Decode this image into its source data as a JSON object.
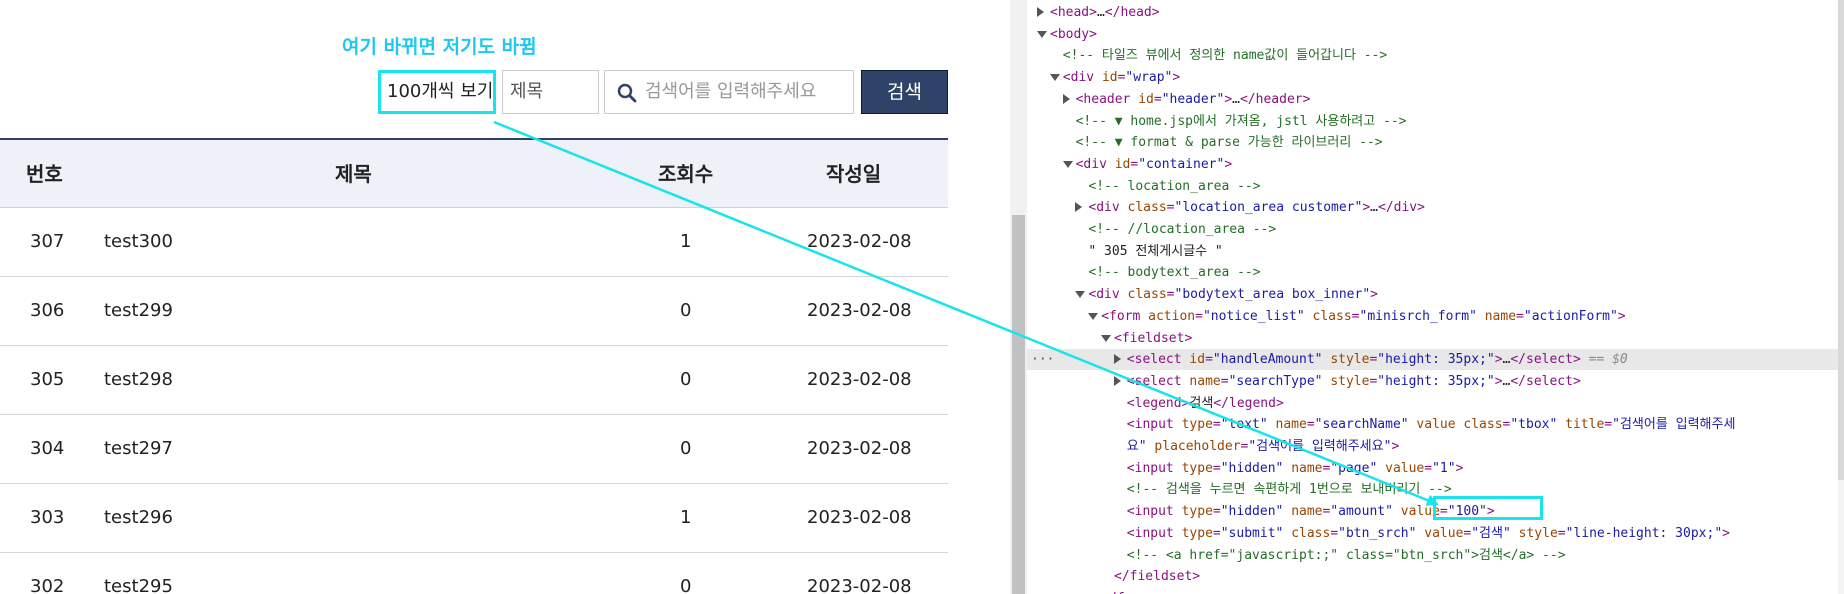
{
  "annotation": {
    "note": "여기 바뀌면 저기도 바뀜",
    "color": "#19e3ec"
  },
  "search": {
    "amount_select": "100개씩 보기",
    "type_select": "제목",
    "placeholder": "검색어를 입력해주세요",
    "button": "검색",
    "search_icon": "search-icon"
  },
  "table": {
    "headers": {
      "no": "번호",
      "title": "제목",
      "views": "조회수",
      "date": "작성일"
    },
    "rows": [
      {
        "no": "307",
        "title": "test300",
        "views": "1",
        "date": "2023-02-08"
      },
      {
        "no": "306",
        "title": "test299",
        "views": "0",
        "date": "2023-02-08"
      },
      {
        "no": "305",
        "title": "test298",
        "views": "0",
        "date": "2023-02-08"
      },
      {
        "no": "304",
        "title": "test297",
        "views": "0",
        "date": "2023-02-08"
      },
      {
        "no": "303",
        "title": "test296",
        "views": "1",
        "date": "2023-02-08"
      },
      {
        "no": "302",
        "title": "test295",
        "views": "0",
        "date": "2023-02-08"
      }
    ]
  },
  "devtools": {
    "lines": [
      {
        "indent": 0,
        "tri": "right",
        "parts": [
          [
            "tag",
            "<head>"
          ],
          [
            "txt",
            "…"
          ],
          [
            "tag",
            "</head>"
          ]
        ]
      },
      {
        "indent": 0,
        "tri": "down",
        "parts": [
          [
            "tag",
            "<body>"
          ]
        ]
      },
      {
        "indent": 1,
        "tri": "",
        "parts": [
          [
            "comment",
            "<!-- 타일즈 뷰에서 정의한 name값이 들어갑니다 -->"
          ]
        ]
      },
      {
        "indent": 1,
        "tri": "down",
        "parts": [
          [
            "tag",
            "<div "
          ],
          [
            "attr",
            "id"
          ],
          [
            "tag",
            "="
          ],
          [
            "val",
            "\"wrap\""
          ],
          [
            "tag",
            ">"
          ]
        ]
      },
      {
        "indent": 2,
        "tri": "right",
        "parts": [
          [
            "tag",
            "<header "
          ],
          [
            "attr",
            "id"
          ],
          [
            "tag",
            "="
          ],
          [
            "val",
            "\"header\""
          ],
          [
            "tag",
            ">"
          ],
          [
            "txt",
            "…"
          ],
          [
            "tag",
            "</header>"
          ]
        ]
      },
      {
        "indent": 2,
        "tri": "",
        "parts": [
          [
            "comment",
            "<!-- ▼ home.jsp에서 가져옴, jstl 사용하려고 -->"
          ]
        ]
      },
      {
        "indent": 2,
        "tri": "",
        "parts": [
          [
            "comment",
            "<!-- ▼ format & parse 가능한 라이브러리  -->"
          ]
        ]
      },
      {
        "indent": 2,
        "tri": "down",
        "parts": [
          [
            "tag",
            "<div "
          ],
          [
            "attr",
            "id"
          ],
          [
            "tag",
            "="
          ],
          [
            "val",
            "\"container\""
          ],
          [
            "tag",
            ">"
          ]
        ]
      },
      {
        "indent": 3,
        "tri": "",
        "parts": [
          [
            "comment",
            "<!-- location_area -->"
          ]
        ]
      },
      {
        "indent": 3,
        "tri": "right",
        "parts": [
          [
            "tag",
            "<div "
          ],
          [
            "attr",
            "class"
          ],
          [
            "tag",
            "="
          ],
          [
            "val",
            "\"location_area customer\""
          ],
          [
            "tag",
            ">"
          ],
          [
            "txt",
            "…"
          ],
          [
            "tag",
            "</div>"
          ]
        ]
      },
      {
        "indent": 3,
        "tri": "",
        "parts": [
          [
            "comment",
            "<!-- //location_area -->"
          ]
        ]
      },
      {
        "indent": 3,
        "tri": "",
        "parts": [
          [
            "txt",
            "\" 305 전체게시글수 \""
          ]
        ]
      },
      {
        "indent": 3,
        "tri": "",
        "parts": [
          [
            "comment",
            "<!-- bodytext_area -->"
          ]
        ]
      },
      {
        "indent": 3,
        "tri": "down",
        "parts": [
          [
            "tag",
            "<div "
          ],
          [
            "attr",
            "class"
          ],
          [
            "tag",
            "="
          ],
          [
            "val",
            "\"bodytext_area box_inner\""
          ],
          [
            "tag",
            ">"
          ]
        ]
      },
      {
        "indent": 4,
        "tri": "down",
        "parts": [
          [
            "tag",
            "<form "
          ],
          [
            "attr",
            "action"
          ],
          [
            "tag",
            "="
          ],
          [
            "val",
            "\"notice_list\""
          ],
          [
            "tag",
            " "
          ],
          [
            "attr",
            "class"
          ],
          [
            "tag",
            "="
          ],
          [
            "val",
            "\"minisrch_form\""
          ],
          [
            "tag",
            " "
          ],
          [
            "attr",
            "name"
          ],
          [
            "tag",
            "="
          ],
          [
            "val",
            "\"actionForm\""
          ],
          [
            "tag",
            ">"
          ]
        ]
      },
      {
        "indent": 5,
        "tri": "down",
        "parts": [
          [
            "tag",
            "<fieldset>"
          ]
        ]
      },
      {
        "indent": 6,
        "tri": "right",
        "selected": true,
        "parts": [
          [
            "tag",
            "<select "
          ],
          [
            "attr",
            "id"
          ],
          [
            "tag",
            "="
          ],
          [
            "val",
            "\"handleAmount\""
          ],
          [
            "tag",
            " "
          ],
          [
            "attr",
            "style"
          ],
          [
            "tag",
            "="
          ],
          [
            "val",
            "\"height: 35px;\""
          ],
          [
            "tag",
            ">"
          ],
          [
            "txt",
            "…"
          ],
          [
            "tag",
            "</select>"
          ],
          [
            "dim",
            " == $0"
          ]
        ]
      },
      {
        "indent": 6,
        "tri": "right",
        "parts": [
          [
            "tag",
            "<select "
          ],
          [
            "attr",
            "name"
          ],
          [
            "tag",
            "="
          ],
          [
            "val",
            "\"searchType\""
          ],
          [
            "tag",
            " "
          ],
          [
            "attr",
            "style"
          ],
          [
            "tag",
            "="
          ],
          [
            "val",
            "\"height: 35px;\""
          ],
          [
            "tag",
            ">"
          ],
          [
            "txt",
            "…"
          ],
          [
            "tag",
            "</select>"
          ]
        ]
      },
      {
        "indent": 6,
        "tri": "",
        "parts": [
          [
            "tag",
            "<legend>"
          ],
          [
            "txt",
            "검색"
          ],
          [
            "tag",
            "</legend>"
          ]
        ]
      },
      {
        "indent": 6,
        "tri": "",
        "parts": [
          [
            "tag",
            "<input "
          ],
          [
            "attr",
            "type"
          ],
          [
            "tag",
            "="
          ],
          [
            "val",
            "\"text\""
          ],
          [
            "tag",
            " "
          ],
          [
            "attr",
            "name"
          ],
          [
            "tag",
            "="
          ],
          [
            "val",
            "\"searchName\""
          ],
          [
            "tag",
            " "
          ],
          [
            "attr",
            "value"
          ],
          [
            "tag",
            " "
          ],
          [
            "attr",
            "class"
          ],
          [
            "tag",
            "="
          ],
          [
            "val",
            "\"tbox\""
          ],
          [
            "tag",
            " "
          ],
          [
            "attr",
            "title"
          ],
          [
            "tag",
            "="
          ],
          [
            "val",
            "\"검색어를 입력해주세"
          ]
        ]
      },
      {
        "indent": 6,
        "tri": "",
        "parts": [
          [
            "val",
            "요\""
          ],
          [
            "tag",
            " "
          ],
          [
            "attr",
            "placeholder"
          ],
          [
            "tag",
            "="
          ],
          [
            "val",
            "\"검색어를 입력해주세요\""
          ],
          [
            "tag",
            ">"
          ]
        ]
      },
      {
        "indent": 6,
        "tri": "",
        "parts": [
          [
            "tag",
            "<input "
          ],
          [
            "attr",
            "type"
          ],
          [
            "tag",
            "="
          ],
          [
            "val",
            "\"hidden\""
          ],
          [
            "tag",
            " "
          ],
          [
            "attr",
            "name"
          ],
          [
            "tag",
            "="
          ],
          [
            "val",
            "\"page\""
          ],
          [
            "tag",
            " "
          ],
          [
            "attr",
            "value"
          ],
          [
            "tag",
            "="
          ],
          [
            "val",
            "\"1\""
          ],
          [
            "tag",
            ">"
          ]
        ]
      },
      {
        "indent": 6,
        "tri": "",
        "parts": [
          [
            "comment",
            "<!-- 검색을 누르면 속편하게 1번으로 보내버리기 -->"
          ]
        ]
      },
      {
        "indent": 6,
        "tri": "",
        "parts": [
          [
            "tag",
            "<input "
          ],
          [
            "attr",
            "type"
          ],
          [
            "tag",
            "="
          ],
          [
            "val",
            "\"hidden\""
          ],
          [
            "tag",
            " "
          ],
          [
            "attr",
            "name"
          ],
          [
            "tag",
            "="
          ],
          [
            "val",
            "\"amount\""
          ],
          [
            "tag",
            " "
          ],
          [
            "attr",
            "value"
          ],
          [
            "tag",
            "="
          ],
          [
            "val",
            "\"100\""
          ],
          [
            "tag",
            ">"
          ]
        ]
      },
      {
        "indent": 6,
        "tri": "",
        "parts": [
          [
            "tag",
            "<input "
          ],
          [
            "attr",
            "type"
          ],
          [
            "tag",
            "="
          ],
          [
            "val",
            "\"submit\""
          ],
          [
            "tag",
            " "
          ],
          [
            "attr",
            "class"
          ],
          [
            "tag",
            "="
          ],
          [
            "val",
            "\"btn_srch\""
          ],
          [
            "tag",
            " "
          ],
          [
            "attr",
            "value"
          ],
          [
            "tag",
            "="
          ],
          [
            "val",
            "\"검색\""
          ],
          [
            "tag",
            " "
          ],
          [
            "attr",
            "style"
          ],
          [
            "tag",
            "="
          ],
          [
            "val",
            "\"line-height: 30px;\""
          ],
          [
            "tag",
            ">"
          ]
        ]
      },
      {
        "indent": 6,
        "tri": "",
        "parts": [
          [
            "comment",
            "<!-- <a href=\"javascript:;\" class=\"btn_srch\">검색</a> -->"
          ]
        ]
      },
      {
        "indent": 5,
        "tri": "",
        "parts": [
          [
            "tag",
            "</fieldset>"
          ]
        ]
      },
      {
        "indent": 4,
        "tri": "",
        "parts": [
          [
            "tag",
            "</form>"
          ]
        ]
      }
    ]
  }
}
